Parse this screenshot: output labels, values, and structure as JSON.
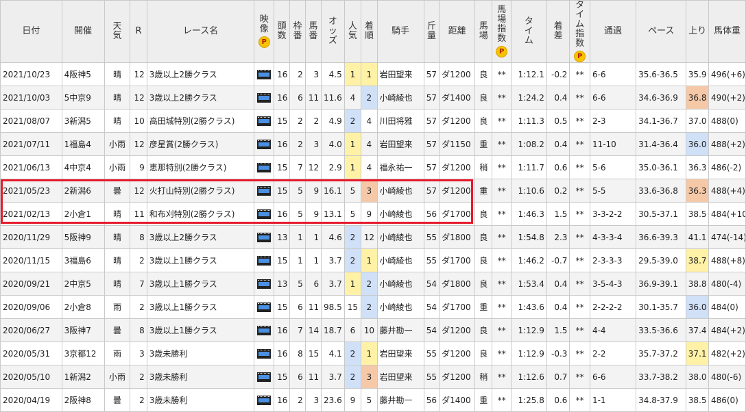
{
  "headers": {
    "date": "日付",
    "venue": "開催",
    "weather": "天気",
    "r": "R",
    "race": "レース名",
    "video": "映像",
    "heads": "頭数",
    "waku": "枠番",
    "umaban": "馬番",
    "odds": "オッズ",
    "pop": "人気",
    "finish": "着順",
    "jockey": "騎手",
    "kinryo": "斤量",
    "distance": "距離",
    "track": "馬場",
    "track_index": "馬場指数",
    "time": "タイム",
    "margin": "着差",
    "time_index": "タイム指数",
    "passing": "通過",
    "pace": "ペース",
    "last3f": "上り",
    "weight": "馬体重",
    "premium_badge": "P"
  },
  "highlight_color": "#e51a2a",
  "rows": [
    {
      "date": "2021/10/23",
      "venue": "4阪神5",
      "weather": "晴",
      "r": "12",
      "race": "3歳以上2勝クラス",
      "heads": "16",
      "waku": "2",
      "umaban": "3",
      "odds": "4.5",
      "pop": "1",
      "finish": "1",
      "jockey": "岩田望来",
      "kinryo": "57",
      "distance": "ダ1200",
      "track": "良",
      "tidx": "**",
      "time": "1:12.1",
      "margin": "-0.2",
      "time_index": "**",
      "passing": "6-6",
      "pace": "35.6-36.5",
      "last3f": "35.9",
      "weight": "496(+6)",
      "pop_c": "y",
      "fin_c": "y",
      "l3_c": ""
    },
    {
      "date": "2021/10/03",
      "venue": "5中京9",
      "weather": "晴",
      "r": "12",
      "race": "3歳以上2勝クラス",
      "heads": "16",
      "waku": "6",
      "umaban": "11",
      "odds": "11.6",
      "pop": "4",
      "finish": "2",
      "jockey": "小崎綾也",
      "kinryo": "57",
      "distance": "ダ1400",
      "track": "良",
      "tidx": "**",
      "time": "1:24.2",
      "margin": "0.4",
      "time_index": "**",
      "passing": "6-6",
      "pace": "34.6-36.9",
      "last3f": "36.8",
      "weight": "490(+2)",
      "pop_c": "",
      "fin_c": "b",
      "l3_c": "o"
    },
    {
      "date": "2021/08/07",
      "venue": "3新潟5",
      "weather": "晴",
      "r": "10",
      "race": "高田城特別(2勝クラス)",
      "heads": "15",
      "waku": "2",
      "umaban": "2",
      "odds": "4.9",
      "pop": "2",
      "finish": "4",
      "jockey": "川田将雅",
      "kinryo": "57",
      "distance": "ダ1200",
      "track": "良",
      "tidx": "**",
      "time": "1:11.3",
      "margin": "0.5",
      "time_index": "**",
      "passing": "2-3",
      "pace": "34.1-36.7",
      "last3f": "37.0",
      "weight": "488(0)",
      "pop_c": "b",
      "fin_c": "",
      "l3_c": ""
    },
    {
      "date": "2021/07/11",
      "venue": "1福島4",
      "weather": "小雨",
      "r": "12",
      "race": "彦星賞(2勝クラス)",
      "heads": "16",
      "waku": "2",
      "umaban": "3",
      "odds": "4.0",
      "pop": "1",
      "finish": "4",
      "jockey": "岩田望来",
      "kinryo": "57",
      "distance": "ダ1150",
      "track": "重",
      "tidx": "**",
      "time": "1:08.2",
      "margin": "0.4",
      "time_index": "**",
      "passing": "11-10",
      "pace": "31.4-36.4",
      "last3f": "36.0",
      "weight": "488(+2)",
      "pop_c": "y",
      "fin_c": "",
      "l3_c": "b"
    },
    {
      "date": "2021/06/13",
      "venue": "4中京4",
      "weather": "小雨",
      "r": "9",
      "race": "恵那特別(2勝クラス)",
      "heads": "15",
      "waku": "7",
      "umaban": "12",
      "odds": "2.9",
      "pop": "1",
      "finish": "4",
      "jockey": "福永祐一",
      "kinryo": "57",
      "distance": "ダ1200",
      "track": "稍",
      "tidx": "**",
      "time": "1:11.7",
      "margin": "0.6",
      "time_index": "**",
      "passing": "5-6",
      "pace": "35.0-36.1",
      "last3f": "36.3",
      "weight": "486(-2)",
      "pop_c": "y",
      "fin_c": "",
      "l3_c": ""
    },
    {
      "date": "2021/05/23",
      "venue": "2新潟6",
      "weather": "曇",
      "r": "12",
      "race": "火打山特別(2勝クラス)",
      "heads": "15",
      "waku": "5",
      "umaban": "9",
      "odds": "16.1",
      "pop": "5",
      "finish": "3",
      "jockey": "小崎綾也",
      "kinryo": "57",
      "distance": "ダ1200",
      "track": "重",
      "tidx": "**",
      "time": "1:10.6",
      "margin": "0.2",
      "time_index": "**",
      "passing": "5-5",
      "pace": "33.6-36.8",
      "last3f": "36.3",
      "weight": "488(+4)",
      "pop_c": "",
      "fin_c": "o",
      "l3_c": "o"
    },
    {
      "date": "2021/02/13",
      "venue": "2小倉1",
      "weather": "晴",
      "r": "11",
      "race": "和布刈特別(2勝クラス)",
      "heads": "16",
      "waku": "5",
      "umaban": "9",
      "odds": "13.1",
      "pop": "5",
      "finish": "9",
      "jockey": "小崎綾也",
      "kinryo": "56",
      "distance": "ダ1700",
      "track": "良",
      "tidx": "**",
      "time": "1:46.3",
      "margin": "1.5",
      "time_index": "**",
      "passing": "3-3-2-2",
      "pace": "30.5-37.1",
      "last3f": "38.5",
      "weight": "484(+10)",
      "pop_c": "",
      "fin_c": "",
      "l3_c": ""
    },
    {
      "date": "2020/11/29",
      "venue": "5阪神9",
      "weather": "晴",
      "r": "8",
      "race": "3歳以上2勝クラス",
      "heads": "13",
      "waku": "1",
      "umaban": "1",
      "odds": "4.6",
      "pop": "2",
      "finish": "12",
      "jockey": "小崎綾也",
      "kinryo": "55",
      "distance": "ダ1800",
      "track": "良",
      "tidx": "**",
      "time": "1:54.8",
      "margin": "2.3",
      "time_index": "**",
      "passing": "4-3-3-4",
      "pace": "36.6-39.3",
      "last3f": "41.1",
      "weight": "474(-14)",
      "pop_c": "b",
      "fin_c": "",
      "l3_c": ""
    },
    {
      "date": "2020/11/15",
      "venue": "3福島6",
      "weather": "晴",
      "r": "2",
      "race": "3歳以上1勝クラス",
      "heads": "15",
      "waku": "1",
      "umaban": "1",
      "odds": "3.7",
      "pop": "2",
      "finish": "1",
      "jockey": "小崎綾也",
      "kinryo": "55",
      "distance": "ダ1700",
      "track": "良",
      "tidx": "**",
      "time": "1:46.2",
      "margin": "-0.7",
      "time_index": "**",
      "passing": "2-3-3-3",
      "pace": "29.5-39.0",
      "last3f": "38.7",
      "weight": "488(+8)",
      "pop_c": "b",
      "fin_c": "y",
      "l3_c": "y"
    },
    {
      "date": "2020/09/21",
      "venue": "2中京5",
      "weather": "晴",
      "r": "7",
      "race": "3歳以上1勝クラス",
      "heads": "13",
      "waku": "5",
      "umaban": "6",
      "odds": "3.7",
      "pop": "1",
      "finish": "2",
      "jockey": "小崎綾也",
      "kinryo": "54",
      "distance": "ダ1800",
      "track": "良",
      "tidx": "**",
      "time": "1:53.4",
      "margin": "0.4",
      "time_index": "**",
      "passing": "3-5-4-3",
      "pace": "36.9-39.1",
      "last3f": "38.8",
      "weight": "480(-4)",
      "pop_c": "y",
      "fin_c": "b",
      "l3_c": ""
    },
    {
      "date": "2020/09/06",
      "venue": "2小倉8",
      "weather": "雨",
      "r": "2",
      "race": "3歳以上1勝クラス",
      "heads": "15",
      "waku": "6",
      "umaban": "11",
      "odds": "98.5",
      "pop": "15",
      "finish": "2",
      "jockey": "小崎綾也",
      "kinryo": "54",
      "distance": "ダ1700",
      "track": "重",
      "tidx": "**",
      "time": "1:43.6",
      "margin": "0.4",
      "time_index": "**",
      "passing": "2-2-2-2",
      "pace": "30.1-35.7",
      "last3f": "36.0",
      "weight": "484(0)",
      "pop_c": "",
      "fin_c": "b",
      "l3_c": "b"
    },
    {
      "date": "2020/06/27",
      "venue": "3阪神7",
      "weather": "曇",
      "r": "8",
      "race": "3歳以上1勝クラス",
      "heads": "16",
      "waku": "7",
      "umaban": "14",
      "odds": "18.7",
      "pop": "6",
      "finish": "10",
      "jockey": "藤井勘一",
      "kinryo": "54",
      "distance": "ダ1200",
      "track": "良",
      "tidx": "**",
      "time": "1:12.9",
      "margin": "1.5",
      "time_index": "**",
      "passing": "4-4",
      "pace": "33.5-36.6",
      "last3f": "37.4",
      "weight": "484(+2)",
      "pop_c": "",
      "fin_c": "",
      "l3_c": ""
    },
    {
      "date": "2020/05/31",
      "venue": "3京都12",
      "weather": "雨",
      "r": "3",
      "race": "3歳未勝利",
      "heads": "16",
      "waku": "8",
      "umaban": "15",
      "odds": "4.1",
      "pop": "2",
      "finish": "1",
      "jockey": "岩田望来",
      "kinryo": "55",
      "distance": "ダ1200",
      "track": "良",
      "tidx": "**",
      "time": "1:12.9",
      "margin": "-0.3",
      "time_index": "**",
      "passing": "2-2",
      "pace": "35.7-37.2",
      "last3f": "37.1",
      "weight": "482(+2)",
      "pop_c": "b",
      "fin_c": "y",
      "l3_c": "y"
    },
    {
      "date": "2020/05/10",
      "venue": "1新潟2",
      "weather": "小雨",
      "r": "2",
      "race": "3歳未勝利",
      "heads": "15",
      "waku": "6",
      "umaban": "11",
      "odds": "3.7",
      "pop": "2",
      "finish": "3",
      "jockey": "岩田望来",
      "kinryo": "55",
      "distance": "ダ1200",
      "track": "稍",
      "tidx": "**",
      "time": "1:12.6",
      "margin": "0.7",
      "time_index": "**",
      "passing": "6-6",
      "pace": "33.7-38.2",
      "last3f": "38.0",
      "weight": "480(-6)",
      "pop_c": "b",
      "fin_c": "o",
      "l3_c": ""
    },
    {
      "date": "2020/04/19",
      "venue": "2阪神8",
      "weather": "曇",
      "r": "2",
      "race": "3歳未勝利",
      "heads": "16",
      "waku": "2",
      "umaban": "3",
      "odds": "23.6",
      "pop": "9",
      "finish": "5",
      "jockey": "藤井勘一",
      "kinryo": "56",
      "distance": "ダ1400",
      "track": "重",
      "tidx": "**",
      "time": "1:25.8",
      "margin": "0.6",
      "time_index": "**",
      "passing": "1-1",
      "pace": "34.8-37.9",
      "last3f": "38.5",
      "weight": "486(0)",
      "pop_c": "",
      "fin_c": "",
      "l3_c": ""
    }
  ]
}
